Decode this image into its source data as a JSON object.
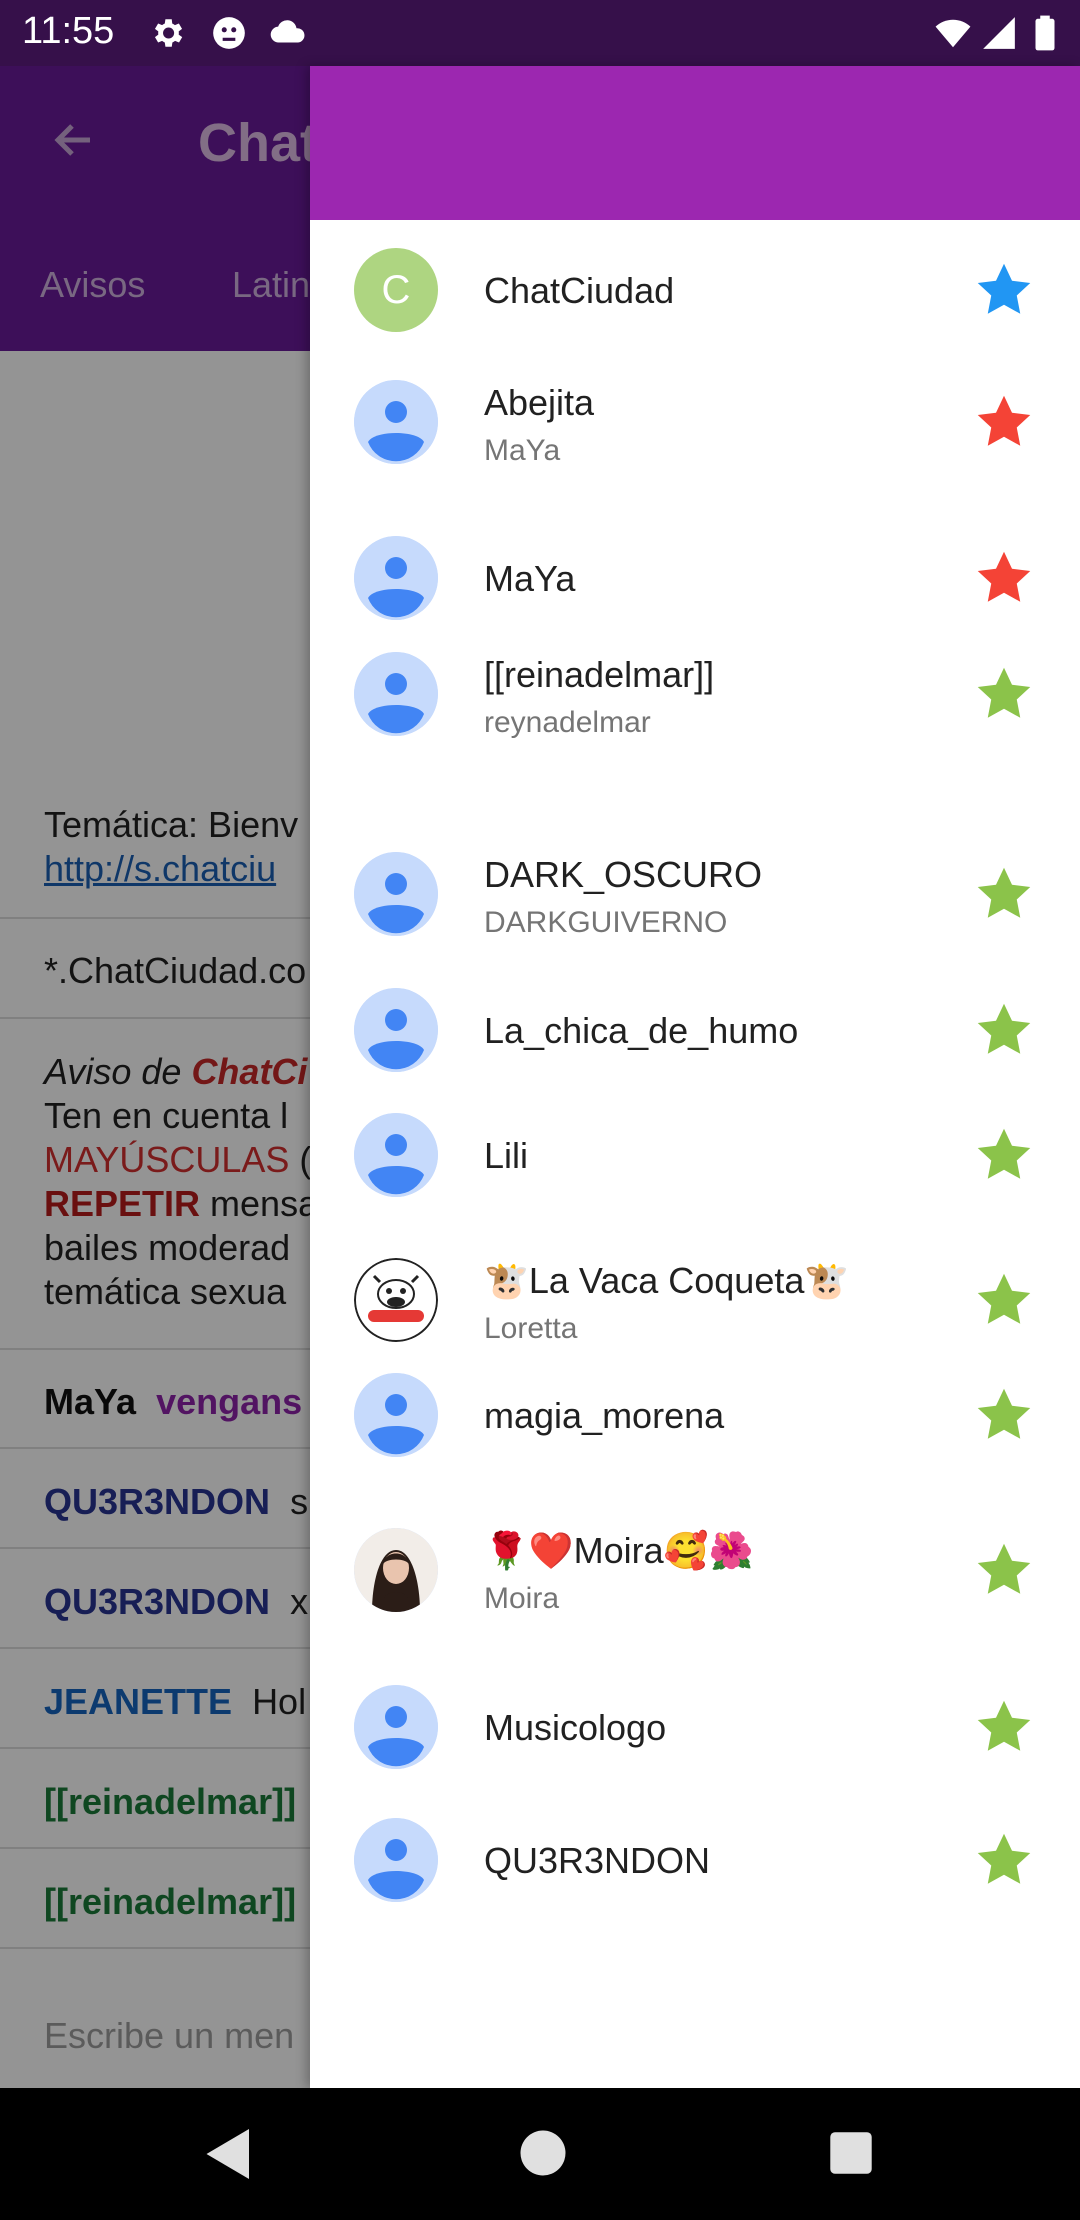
{
  "status_bar": {
    "time": "11:55"
  },
  "app": {
    "title": "Chat",
    "tabs": [
      "Avisos",
      "Latin"
    ],
    "chat": {
      "topic_line1": "Temática: Bienv",
      "topic_link": "http://s.chatciu",
      "line_site": "*.ChatCiudad.co",
      "aviso_prefix": "Aviso de ",
      "aviso_brand": "ChatCi",
      "aviso_l2": "Ten en cuenta l",
      "aviso_l3_red": "MAYÚSCULAS",
      "aviso_l3_rest": " (",
      "aviso_l4_red": "REPETIR",
      "aviso_l4_rest": " mensa",
      "aviso_l5": "bailes moderad",
      "aviso_l6": "temática sexua",
      "messages": [
        {
          "nick": "MaYa",
          "text": "vengans"
        },
        {
          "nick": "QU3R3NDON",
          "text": "s"
        },
        {
          "nick": "QU3R3NDON",
          "text": "x"
        },
        {
          "nick": "JEANETTE",
          "text": "Hol"
        },
        {
          "nick": "[[reinadelmar]]",
          "text": ""
        },
        {
          "nick": "[[reinadelmar]]",
          "text": ""
        }
      ],
      "input_placeholder": "Escribe un men"
    }
  },
  "drawer": {
    "items": [
      {
        "name": "ChatCiudad",
        "sub": "",
        "avatar": "letter-c-icon",
        "avatar_letter": "C",
        "star_color": "#2196f3"
      },
      {
        "name": "Abejita",
        "sub": "MaYa",
        "avatar": "person-icon",
        "star_color": "#f44336"
      },
      {
        "name": "MaYa",
        "sub": "",
        "avatar": "person-icon",
        "star_color": "#f44336"
      },
      {
        "name": "[[reinadelmar]]",
        "sub": "reynadelmar",
        "avatar": "person-icon",
        "star_color": "#8bc34a"
      },
      {
        "name": "DARK_OSCURO",
        "sub": "DARKGUIVERNO",
        "avatar": "person-icon",
        "star_color": "#8bc34a"
      },
      {
        "name": "La_chica_de_humo",
        "sub": "",
        "avatar": "person-icon",
        "star_color": "#8bc34a"
      },
      {
        "name": "Lili",
        "sub": "",
        "avatar": "person-icon",
        "star_color": "#8bc34a"
      },
      {
        "name": "🐮La Vaca Coqueta🐮",
        "sub": "Loretta",
        "avatar": "cow-logo-avatar",
        "star_color": "#8bc34a"
      },
      {
        "name": "magia_morena",
        "sub": "",
        "avatar": "person-icon",
        "star_color": "#8bc34a"
      },
      {
        "name": "🌹❤️Moira🥰🌺",
        "sub": "Moira",
        "avatar": "photo-avatar",
        "star_color": "#8bc34a"
      },
      {
        "name": "Musicologo",
        "sub": "",
        "avatar": "person-icon",
        "star_color": "#8bc34a"
      },
      {
        "name": "QU3R3NDON",
        "sub": "",
        "avatar": "person-icon",
        "star_color": "#8bc34a"
      }
    ]
  },
  "colors": {
    "status_bar": "#36104a",
    "app_bar": "#6a1b9a",
    "drawer_header": "#9c27b0"
  }
}
